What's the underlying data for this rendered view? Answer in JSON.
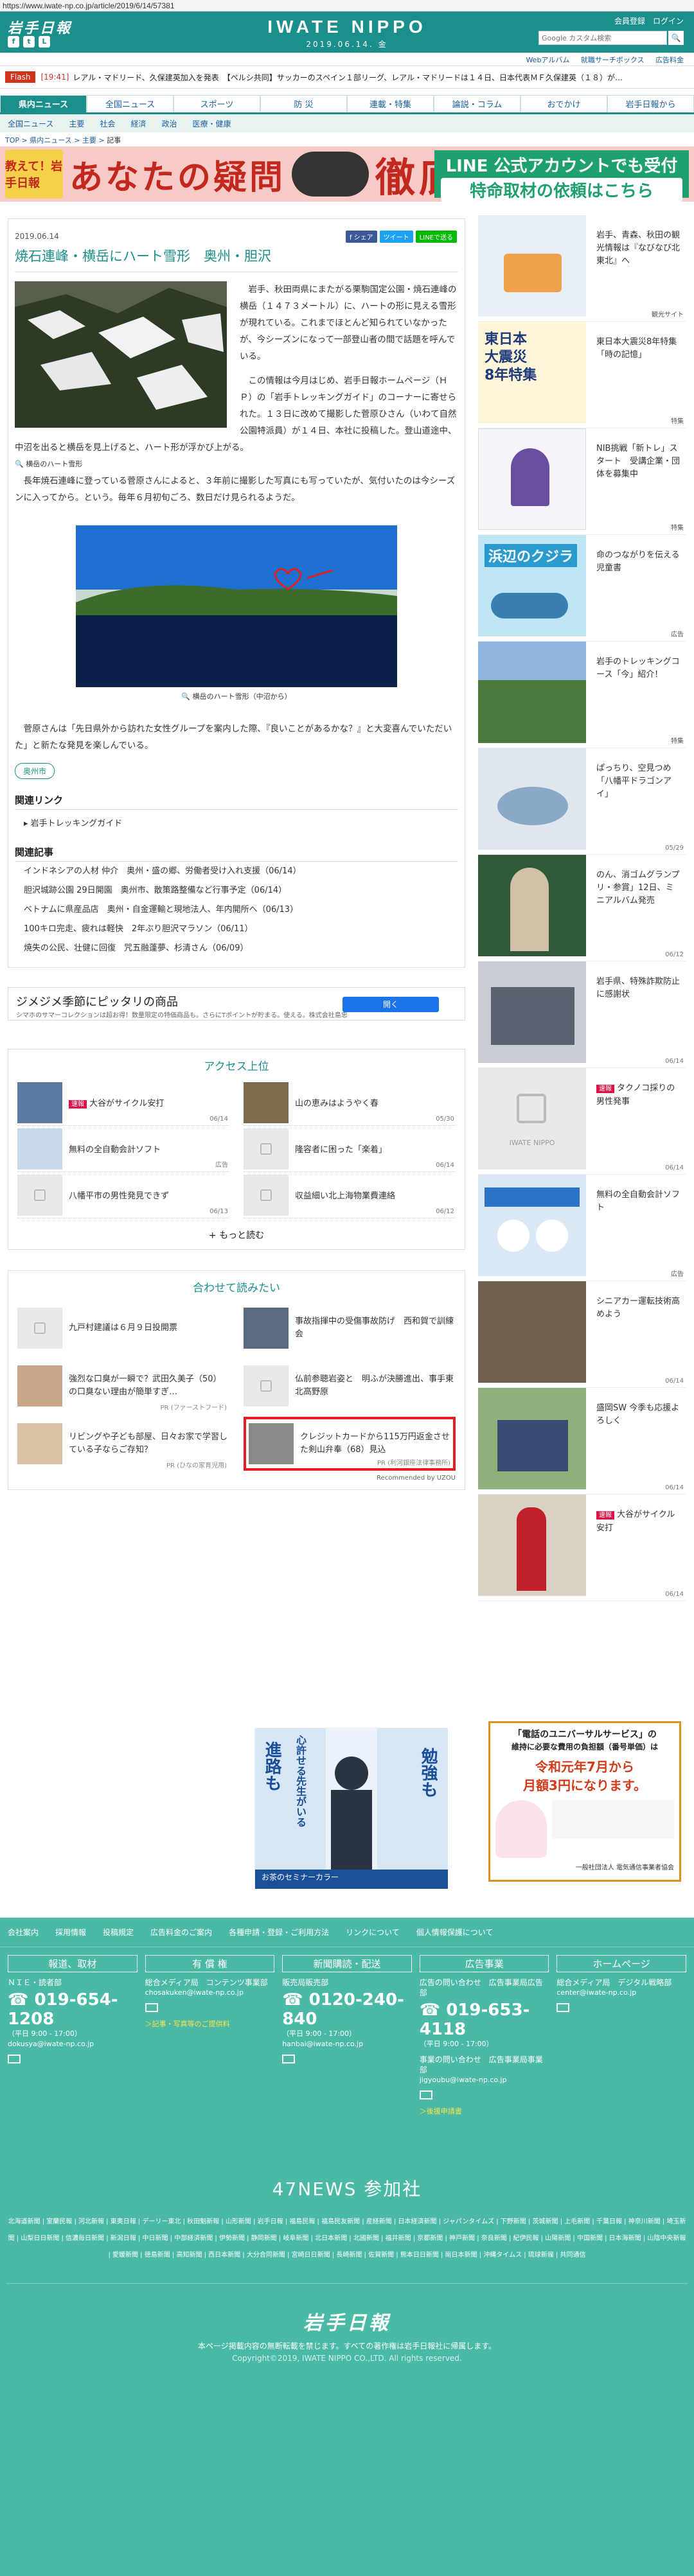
{
  "url": "https://www.iwate-np.co.jp/article/2019/6/14/57381",
  "header": {
    "logo_left": "岩手日報",
    "logo_center": "IWATE NIPPO",
    "date": "2019.06.14. 金",
    "links": [
      "会員登録",
      "ログイン"
    ],
    "search_placeholder": "Google カスタム検索",
    "sub_links": [
      "Webアルバム",
      "就職サーチボックス",
      "広告料金"
    ]
  },
  "flash": {
    "tag": "Flash",
    "time": "[19:41]",
    "text": "レアル・マドリード、久保建英加入を発表　【ペルシ共同】サッカーのスペイン１部リーグ、レアル・マドリードは１４日、日本代表ＭＦ久保建英（１８）が…"
  },
  "nav": [
    "県内ニュース",
    "全国ニュース",
    "スポーツ",
    "防 災",
    "連載・特集",
    "論説・コラム",
    "おでかけ",
    "岩手日報から"
  ],
  "subnav": [
    "全国ニュース",
    "主要",
    "社会",
    "経済",
    "政治",
    "医療・健康"
  ],
  "breadcrumb": [
    "TOP",
    "県内ニュース",
    "主要",
    "記事"
  ],
  "banner": {
    "badge": "教えて！岩手日報",
    "title": "あなたの疑問",
    "title2": "徹底解明",
    "line1": "LINE 公式アカウントでも受付",
    "line2": "特命取材の依頼はこちら"
  },
  "article": {
    "date": "2019.06.14",
    "share": [
      "f シェア",
      "ツイート",
      "LINEで送る"
    ],
    "title": "焼石連峰・横岳にハート雪形　奥州・胆沢",
    "caption1": "横岳のハート雪形",
    "p1": "岩手、秋田両県にまたがる栗駒国定公園・焼石連峰の横岳（１４７３メートル）に、ハートの形に見える雪形が現れている。これまでほとんど知られていなかったが、今シーズンになって一部登山者の間で話題を呼んでいる。",
    "p2": "この情報は今月はじめ、岩手日報ホームページ（ＨＰ）の「岩手トレッキングガイド」のコーナーに寄せられた。１３日に改めて撮影した菅原ひさん（いわて自然公園特派員）が１４日、本社に投稿した。登山道途中、中沼を出ると横岳を見上げると、ハート形が浮かび上がる。",
    "p3": "長年焼石連峰に登っている菅原さんによると、３年前に撮影した写真にも写っていたが、気付いたのは今シーズンに入ってから。という。毎年６月初旬ごろ、数日だけ見られるようだ。",
    "caption2": "横岳のハート雪形（中沼から）",
    "p4": "菅原さんは「先日県外から訪れた女性グループを案内した際、『良いことがあるかな？』と大変喜んでいただいた」と新たな発見を楽しんでいる。",
    "tag": "奥州市",
    "related_link_h": "関連リンク",
    "related_link": "岩手トレッキングガイド",
    "related_news_h": "関連記事",
    "related_news": [
      "インドネシアの人材 仲介　奥州・盛の郷、労働者受け入れ支援（06/14）",
      "胆沢城跡公園 29日開園　奥州市、散策路整備など行事予定（06/14）",
      "ベトナムに県産品店　奥州・自金運輸と現地法人、年内開所へ（06/13）",
      "100キロ完走、疲れは軽快　2年ぶり胆沢マラソン（06/11）",
      "焼失の公民、壮健に回復　咒五融蓬夢、杉清さん（06/09）"
    ]
  },
  "ad_row": {
    "title": "ジメジメ季節にピッタリの商品",
    "sub": "シマホのサマーコレクションは超お得！数量限定の特価商品も。さらにTポイントが貯まる。使える。株式会社島忠",
    "button": "開く"
  },
  "ranking": {
    "heading": "アクセス上位",
    "badge": "速報",
    "items": [
      {
        "text": "大谷がサイクル安打",
        "date": "06/14"
      },
      {
        "text": "山の恵みはようやく春",
        "date": "05/30"
      },
      {
        "text": "無料の全自動会計ソフト",
        "date": "広告"
      },
      {
        "text": "隆容者に困った「楽着」",
        "date": "06/14"
      },
      {
        "text": "八幡平市の男性発見できず",
        "date": "06/13"
      },
      {
        "text": "収益細い北上海物業費連絡",
        "date": "06/12"
      }
    ],
    "more": "もっと読む"
  },
  "recommend": {
    "heading": "合わせて読みたい",
    "items": [
      {
        "text": "九戸村建議は６月９日投開票",
        "pr": ""
      },
      {
        "text": "事故指揮中の受傷事故防げ　西和賀で訓練会",
        "pr": ""
      },
      {
        "text": "強烈な口臭が一瞬で？武田久美子（50）の口臭ない理由が簡単すぎ…",
        "pr": "PR (ファーストフード)"
      },
      {
        "text": "仏前参聴岩姿と　明ふが決勝進出、事手東北高野原",
        "pr": ""
      },
      {
        "text": "リビングや子ども部屋、日々お家で学習している子ならご存知？",
        "pr": "PR (ひなの家育児用)"
      },
      {
        "text": "クレジットカードから115万円返金させた剣山弁奉（68）見込",
        "pr": "PR (利河銀座法律事務所)"
      }
    ],
    "footer": "Recommended by UZOU"
  },
  "ad_bottom_left": {
    "tag1": "進路も",
    "tag2": "心許せる先生がいる",
    "tag3": "勉強も",
    "bottom": "お茶のセミナーカラー"
  },
  "ad_bottom_right": {
    "l1": "「電話のユニバーサルサービス」の",
    "l2": "維持に必要な費用の負担額（番号単価）は",
    "l3": "令和元年7月から",
    "l4": "月額3円になります。",
    "l5": "一般社団法人 電気通信事業者協会"
  },
  "side": [
    {
      "text": "岩手、青森、秋田の観光情報は『なびなび北東北』へ",
      "date": "観光サイト"
    },
    {
      "text": "東日本大震災8年特集「時の記憶」",
      "date": "特集"
    },
    {
      "text": "NIB挑戦「新トレ」スタート　受講企業・団体を募集中",
      "date": "特集"
    },
    {
      "text": "命のつながりを伝える児童書",
      "date": "広告"
    },
    {
      "text": "岩手のトレッキングコース「今」紹介！",
      "date": "特集"
    },
    {
      "text": "ぱっちり、空見つめ「八幡平ドラゴンアイ」",
      "date": "05/29"
    },
    {
      "text": "のん、消ゴムグランプリ・参賞」12日、ミニアルバム発売",
      "date": "06/12"
    },
    {
      "text": "岩手県、特殊詐欺防止に感謝状",
      "date": "06/14"
    },
    {
      "text": "タクノコ採りの男性発事",
      "date": "06/14"
    },
    {
      "text": "無料の全自動会計ソフト",
      "date": "広告"
    },
    {
      "text": "シニアカー運転技術高めよう",
      "date": "06/14"
    },
    {
      "text": "盛岡SW 今季も応援よろしく",
      "date": "06/14"
    },
    {
      "text": "大谷がサイクル安打",
      "date": "06/14"
    }
  ],
  "footer": {
    "top_links": [
      "会社案内",
      "採用情報",
      "投稿規定",
      "広告料金のご案内",
      "各種申請・登録・ご利用方法",
      "リンクについて",
      "個人情報保護について"
    ],
    "cols": [
      {
        "h": "報道、取材",
        "sub": "ＮＩＥ・読者部",
        "tel": "019-654-1208",
        "small": "（平日 9:00 - 17:00）",
        "mail": "dokusya@iwate-np.co.jp",
        "link": ""
      },
      {
        "h": "有 償 権",
        "sub": "総合メディア局　コンテンツ事業部",
        "tel": "",
        "small": "",
        "mail": "chosakuken@iwate-np.co.jp",
        "link": "＞記事・写真等のご提供料"
      },
      {
        "h": "新聞購読・配送",
        "sub": "販売局販売部",
        "tel": "0120-240-840",
        "small": "（平日 9:00 - 17:00）",
        "mail": "hanbai@iwate-np.co.jp",
        "link": ""
      },
      {
        "h": "広告事業",
        "sub": "広告の問い合わせ　広告事業局広告部",
        "tel": "019-653-4118",
        "small": "（平日 9:00 - 17:00）",
        "mail": "jigyoubu@iwate-np.co.jp",
        "link": "＞後援申請書"
      },
      {
        "h": "ホームページ",
        "sub": "総合メディア局　デジタル戦略部",
        "tel": "",
        "small": "",
        "mail": "center@iwate-np.co.jp",
        "link": ""
      }
    ],
    "extra_col4": "事業の問い合わせ　広告事業局事業部",
    "n47": "47NEWS 参加社",
    "n47_list": "北海道新聞 | 室蘭民報 | 河北新報 | 東奥日報 | デーリー東北 | 秋田魁新報 | 山形新聞 | 岩手日報 | 福島民報 | 福島民友新聞 | 産経新聞 | 日本経済新聞 | ジャパンタイムズ | 下野新聞 | 茨城新聞 | 上毛新聞 | 千葉日報 | 神奈川新聞 | 埼玉新聞 | 山梨日日新聞 | 信濃毎日新聞 | 新潟日報 | 中日新聞 | 中部経済新聞 | 伊勢新聞 | 静岡新聞 | 岐阜新聞 | 北日本新聞 | 北國新聞 | 福井新聞 | 京都新聞 | 神戸新聞 | 奈良新聞 | 紀伊民報 | 山陽新聞 | 中国新聞 | 日本海新聞 | 山陰中央新報 | 愛媛新聞 | 徳島新聞 | 高知新聞 | 西日本新聞 | 大分合同新聞 | 宮崎日日新聞 | 長崎新聞 | 佐賀新聞 | 熊本日日新聞 | 南日本新聞 | 沖縄タイムス | 琉球新報 | 共同通信",
    "logo": "岩手日報",
    "note": "本ページ掲載内容の無断転載を禁じます。すべての著作権は岩手日報社に帰属します。",
    "copy": "Copyright©2019, IWATE NIPPO CO.,LTD. All rights reserved."
  }
}
